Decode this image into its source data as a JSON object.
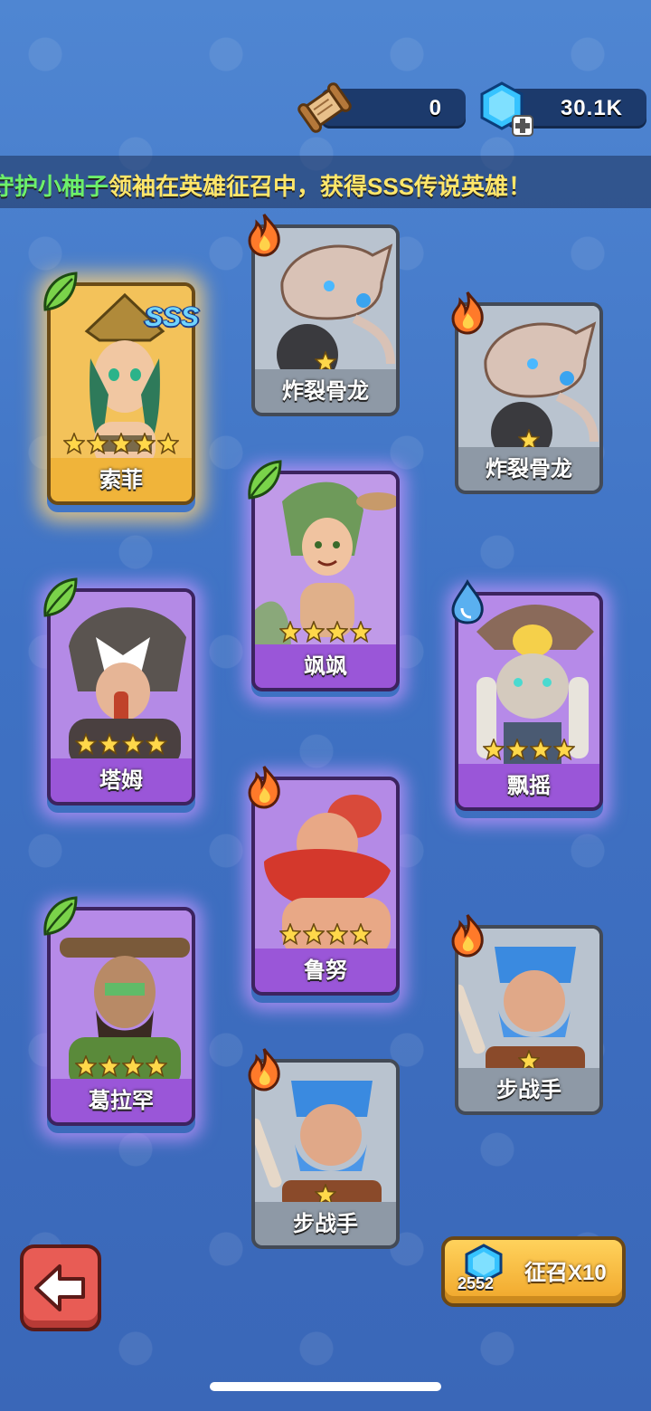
{
  "currency": {
    "scroll_count": "0",
    "gem_count": "30.1K"
  },
  "banner": {
    "player": "守护小柚子",
    "message": "领袖在英雄征召中，获得SSS传说英雄！"
  },
  "cards": [
    {
      "name": "索菲",
      "rarity": "gold",
      "element": "leaf-icon",
      "stars": 5,
      "badge": "SSS"
    },
    {
      "name": "炸裂骨龙",
      "rarity": "gray",
      "element": "fire-icon",
      "stars": 1
    },
    {
      "name": "炸裂骨龙",
      "rarity": "gray",
      "element": "fire-icon",
      "stars": 1
    },
    {
      "name": "飒飒",
      "rarity": "purple",
      "element": "leaf-icon",
      "stars": 4
    },
    {
      "name": "塔姆",
      "rarity": "purple",
      "element": "leaf-icon",
      "stars": 4
    },
    {
      "name": "飘摇",
      "rarity": "purple",
      "element": "water-icon",
      "stars": 4
    },
    {
      "name": "鲁努",
      "rarity": "purple",
      "element": "fire-icon",
      "stars": 4
    },
    {
      "name": "葛拉罕",
      "rarity": "purple",
      "element": "leaf-icon",
      "stars": 4
    },
    {
      "name": "步战手",
      "rarity": "gray",
      "element": "fire-icon",
      "stars": 1
    },
    {
      "name": "步战手",
      "rarity": "gray",
      "element": "fire-icon",
      "stars": 1
    }
  ],
  "buttons": {
    "back": "arrow-left-icon",
    "recruit_label": "征召X10",
    "recruit_cost": "2552"
  },
  "colors": {
    "background": "#4579c8",
    "gold": "#f0b43a",
    "purple": "#9a56d8",
    "gray": "#8e99a6"
  }
}
